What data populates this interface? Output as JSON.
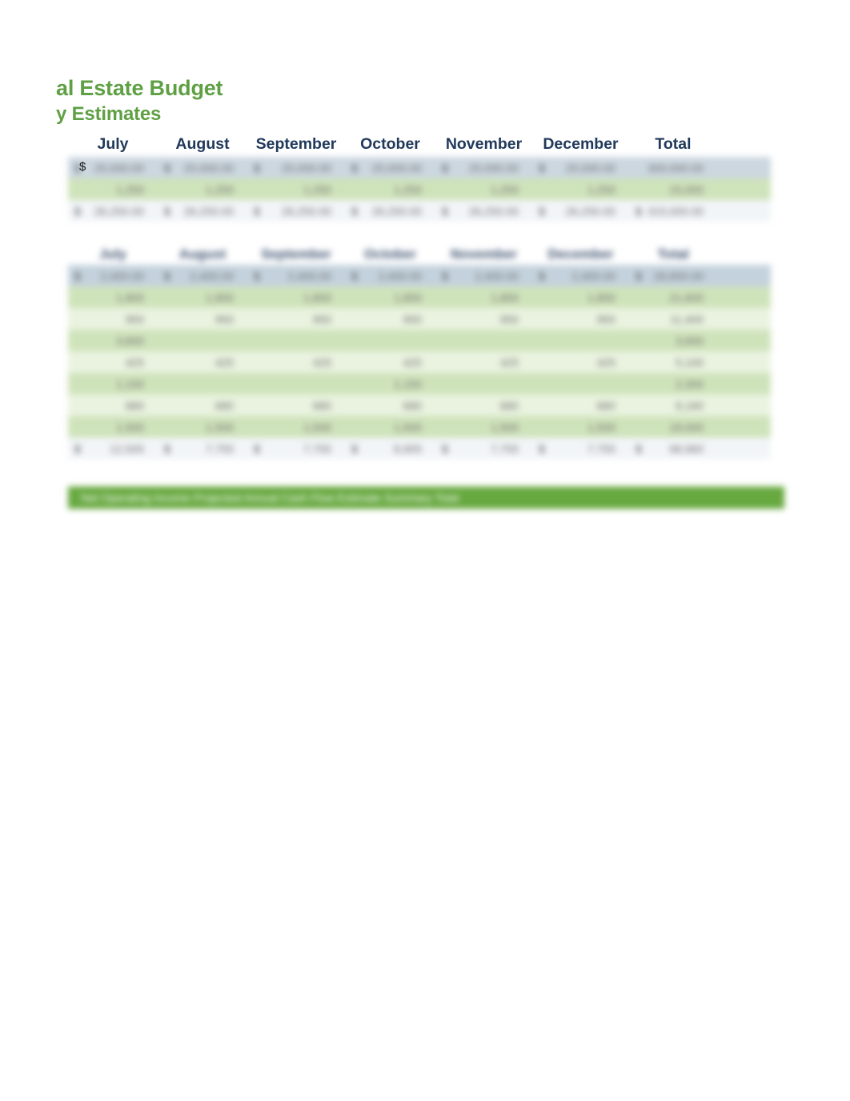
{
  "document": {
    "title_line1": "al Estate Budget",
    "title_line2": "y Estimates",
    "title_color": "#5fa044",
    "header_text_color": "#21395b",
    "footer_bar_color": "#67a83f",
    "band_dark": "#cfe3bb",
    "band_light": "#eaf3e0",
    "header_band": "#ccd7e0"
  },
  "columns": {
    "july": "July",
    "august": "August",
    "september": "September",
    "october": "October",
    "november": "November",
    "december": "December",
    "total": "Total"
  },
  "currency_symbol": "$",
  "table_one": {
    "rows": [
      {
        "style": "bg-head",
        "cells": [
          {
            "cur": "$",
            "amt": "25,000.00"
          },
          {
            "cur": "$",
            "amt": "25,000.00"
          },
          {
            "cur": "$",
            "amt": "25,000.00"
          },
          {
            "cur": "$",
            "amt": "25,000.00"
          },
          {
            "cur": "$",
            "amt": "25,000.00"
          },
          {
            "cur": "$",
            "amt": "25,000.00"
          },
          {
            "cur": "",
            "amt": "300,000.00"
          }
        ]
      },
      {
        "style": "bg-greenA",
        "cells": [
          {
            "cur": "",
            "amt": "1,250"
          },
          {
            "cur": "",
            "amt": "1,250"
          },
          {
            "cur": "",
            "amt": "1,250"
          },
          {
            "cur": "",
            "amt": "1,250"
          },
          {
            "cur": "",
            "amt": "1,250"
          },
          {
            "cur": "",
            "amt": "1,250"
          },
          {
            "cur": "",
            "amt": "15,000"
          }
        ]
      },
      {
        "style": "bg-total",
        "cells": [
          {
            "cur": "$",
            "amt": "26,250.00"
          },
          {
            "cur": "$",
            "amt": "26,250.00"
          },
          {
            "cur": "$",
            "amt": "26,250.00"
          },
          {
            "cur": "$",
            "amt": "26,250.00"
          },
          {
            "cur": "$",
            "amt": "26,250.00"
          },
          {
            "cur": "$",
            "amt": "26,250.00"
          },
          {
            "cur": "$",
            "amt": "315,000.00"
          }
        ]
      }
    ]
  },
  "table_two": {
    "header_row": {
      "july": "July",
      "august": "August",
      "september": "September",
      "october": "October",
      "november": "November",
      "december": "December",
      "total": "Total"
    },
    "rows": [
      {
        "style": "bg-subhead",
        "cells": [
          {
            "cur": "$",
            "amt": "2,400.00"
          },
          {
            "cur": "$",
            "amt": "2,400.00"
          },
          {
            "cur": "$",
            "amt": "2,400.00"
          },
          {
            "cur": "$",
            "amt": "2,400.00"
          },
          {
            "cur": "$",
            "amt": "2,400.00"
          },
          {
            "cur": "$",
            "amt": "2,400.00"
          },
          {
            "cur": "$",
            "amt": "28,800.00"
          }
        ]
      },
      {
        "style": "bg-greenA",
        "cells": [
          {
            "cur": "",
            "amt": "1,800"
          },
          {
            "cur": "",
            "amt": "1,800"
          },
          {
            "cur": "",
            "amt": "1,800"
          },
          {
            "cur": "",
            "amt": "1,800"
          },
          {
            "cur": "",
            "amt": "1,800"
          },
          {
            "cur": "",
            "amt": "1,800"
          },
          {
            "cur": "",
            "amt": "21,600"
          }
        ]
      },
      {
        "style": "bg-greenB",
        "cells": [
          {
            "cur": "",
            "amt": "950"
          },
          {
            "cur": "",
            "amt": "950"
          },
          {
            "cur": "",
            "amt": "950"
          },
          {
            "cur": "",
            "amt": "950"
          },
          {
            "cur": "",
            "amt": "950"
          },
          {
            "cur": "",
            "amt": "950"
          },
          {
            "cur": "",
            "amt": "11,400"
          }
        ]
      },
      {
        "style": "bg-greenA",
        "cells": [
          {
            "cur": "",
            "amt": "3,600"
          },
          {
            "cur": "",
            "amt": ""
          },
          {
            "cur": "",
            "amt": ""
          },
          {
            "cur": "",
            "amt": ""
          },
          {
            "cur": "",
            "amt": ""
          },
          {
            "cur": "",
            "amt": ""
          },
          {
            "cur": "",
            "amt": "3,600"
          }
        ]
      },
      {
        "style": "bg-greenB",
        "cells": [
          {
            "cur": "",
            "amt": "425"
          },
          {
            "cur": "",
            "amt": "425"
          },
          {
            "cur": "",
            "amt": "425"
          },
          {
            "cur": "",
            "amt": "425"
          },
          {
            "cur": "",
            "amt": "425"
          },
          {
            "cur": "",
            "amt": "425"
          },
          {
            "cur": "",
            "amt": "5,100"
          }
        ]
      },
      {
        "style": "bg-greenA",
        "cells": [
          {
            "cur": "",
            "amt": "1,150"
          },
          {
            "cur": "",
            "amt": ""
          },
          {
            "cur": "",
            "amt": ""
          },
          {
            "cur": "",
            "amt": "1,150"
          },
          {
            "cur": "",
            "amt": ""
          },
          {
            "cur": "",
            "amt": ""
          },
          {
            "cur": "",
            "amt": "2,300"
          }
        ]
      },
      {
        "style": "bg-greenB",
        "cells": [
          {
            "cur": "",
            "amt": "680"
          },
          {
            "cur": "",
            "amt": "680"
          },
          {
            "cur": "",
            "amt": "680"
          },
          {
            "cur": "",
            "amt": "680"
          },
          {
            "cur": "",
            "amt": "680"
          },
          {
            "cur": "",
            "amt": "680"
          },
          {
            "cur": "",
            "amt": "8,160"
          }
        ]
      },
      {
        "style": "bg-greenA",
        "cells": [
          {
            "cur": "",
            "amt": "1,500"
          },
          {
            "cur": "",
            "amt": "1,500"
          },
          {
            "cur": "",
            "amt": "1,500"
          },
          {
            "cur": "",
            "amt": "1,500"
          },
          {
            "cur": "",
            "amt": "1,500"
          },
          {
            "cur": "",
            "amt": "1,500"
          },
          {
            "cur": "",
            "amt": "18,000"
          }
        ]
      },
      {
        "style": "bg-total",
        "cells": [
          {
            "cur": "$",
            "amt": "12,505"
          },
          {
            "cur": "$",
            "amt": "7,755"
          },
          {
            "cur": "$",
            "amt": "7,755"
          },
          {
            "cur": "$",
            "amt": "8,905"
          },
          {
            "cur": "$",
            "amt": "7,755"
          },
          {
            "cur": "$",
            "amt": "7,755"
          },
          {
            "cur": "$",
            "amt": "98,960"
          }
        ]
      }
    ]
  },
  "footer": {
    "text": "Net Operating Income Projected Annual Cash Flow Estimate Summary Total"
  }
}
